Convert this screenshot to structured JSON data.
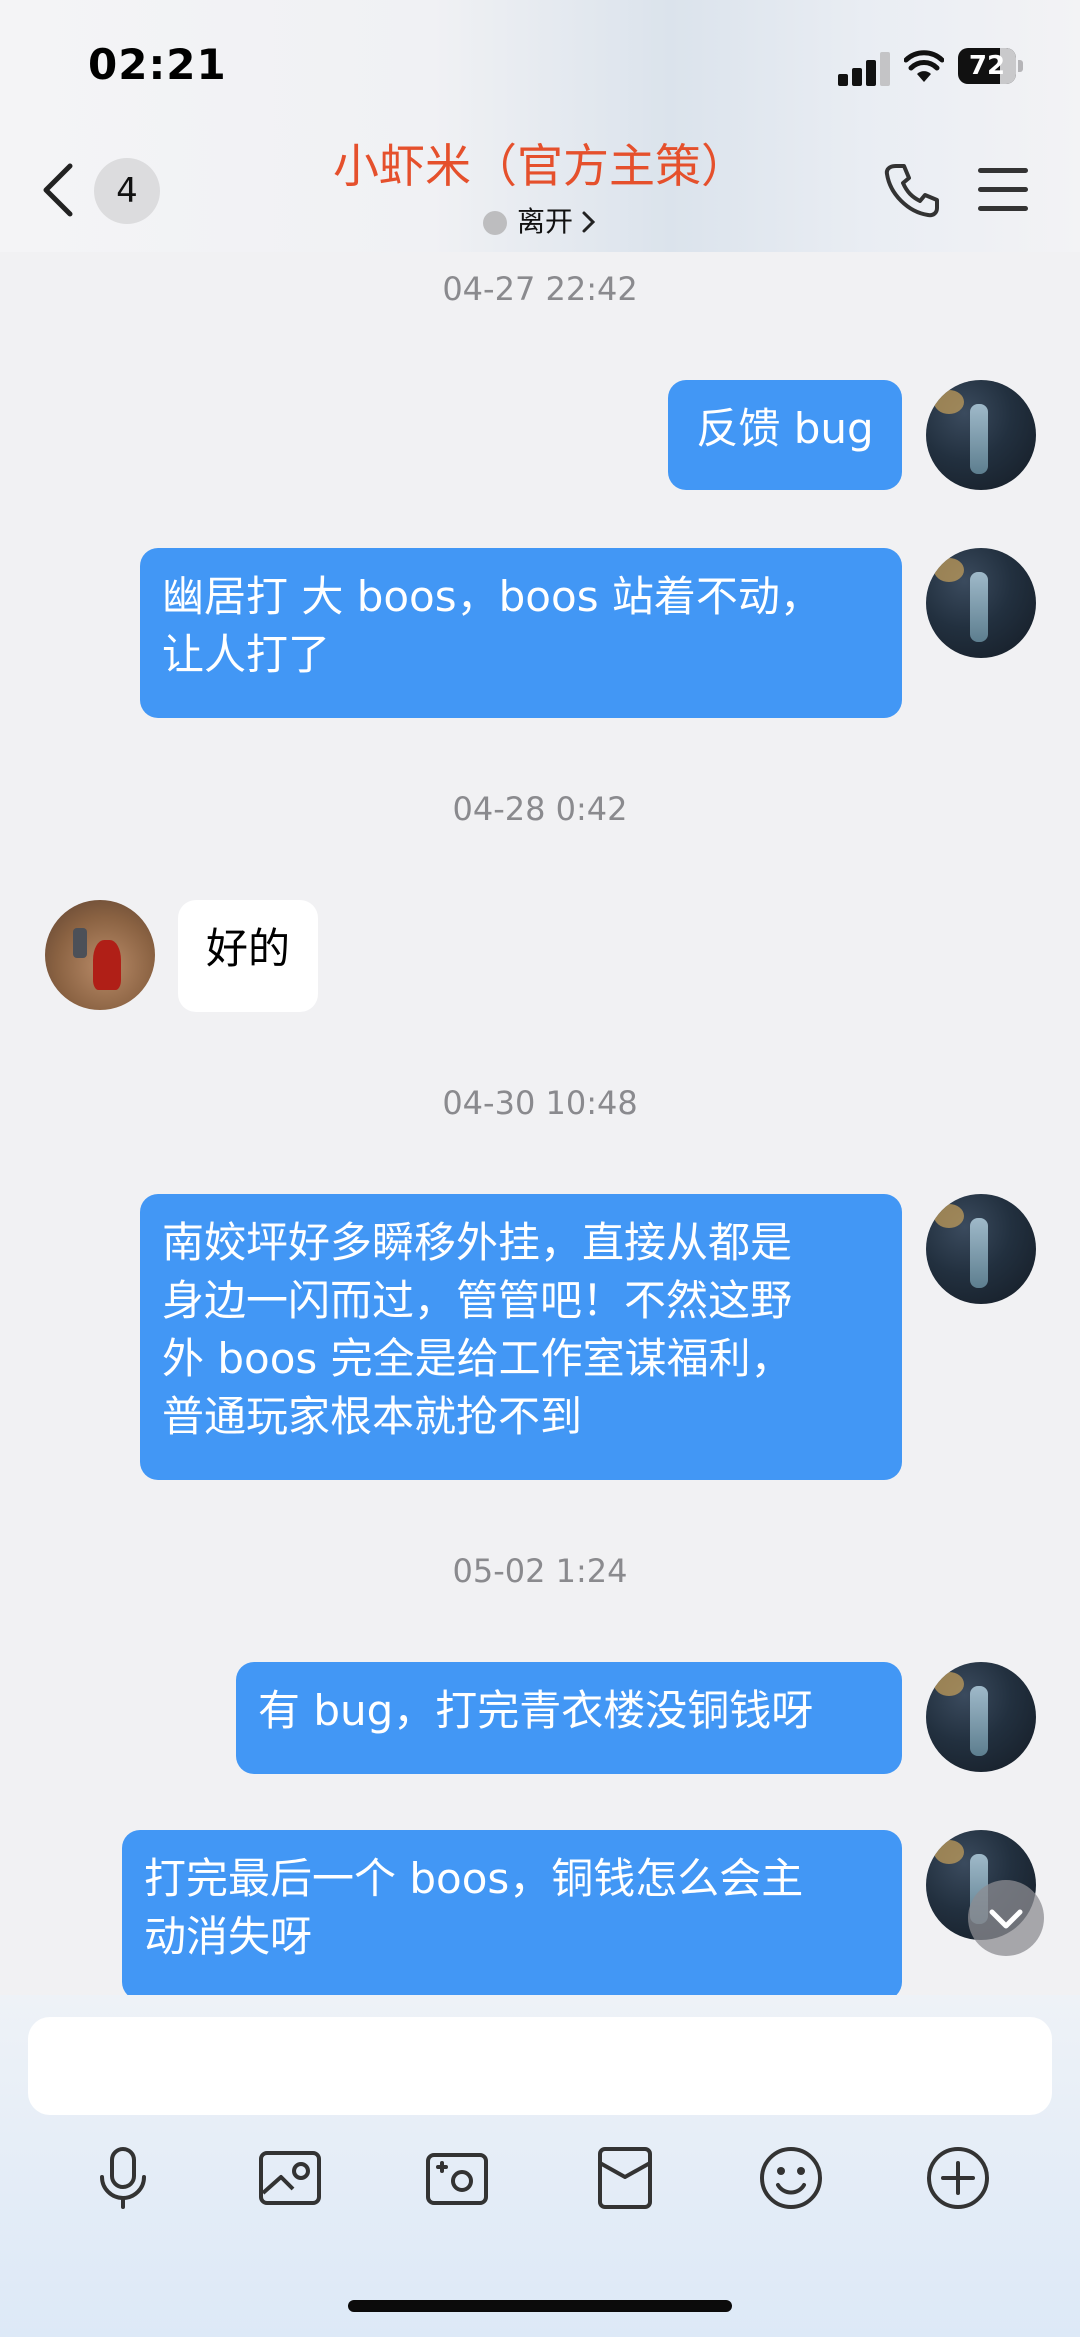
{
  "status_bar": {
    "time": "02:21",
    "battery": "72"
  },
  "header": {
    "unread_count": "4",
    "title": "小虾米（官方主策）",
    "status": "离开",
    "accent_color": "#e5502c"
  },
  "messages": [
    {
      "type": "timestamp",
      "text": "04-27 22:42"
    },
    {
      "type": "outgoing",
      "text": "反馈 bug"
    },
    {
      "type": "outgoing",
      "lines": [
        "幽居打 大 boos，boos 站着不动，",
        "让人打了"
      ]
    },
    {
      "type": "timestamp",
      "text": "04-28 0:42"
    },
    {
      "type": "incoming",
      "text": "好的"
    },
    {
      "type": "timestamp",
      "text": "04-30 10:48"
    },
    {
      "type": "outgoing",
      "lines": [
        "南姣坪好多瞬移外挂，直接从都是",
        "身边一闪而过，管管吧！不然这野",
        "外 boos 完全是给工作室谋福利，",
        "普通玩家根本就抢不到"
      ]
    },
    {
      "type": "timestamp",
      "text": "05-02 1:24"
    },
    {
      "type": "outgoing",
      "text": "有 bug，打完青衣楼没铜钱呀"
    },
    {
      "type": "outgoing",
      "lines": [
        "打完最后一个 boos，铜钱怎么会主",
        "动消失呀"
      ]
    }
  ],
  "colors": {
    "outgoing_bubble": "#4297f5",
    "incoming_bubble": "#ffffff",
    "background": "#f1f1f3"
  },
  "input": {
    "placeholder": ""
  },
  "toolbar_icons": [
    "microphone-icon",
    "image-icon",
    "camera-icon",
    "red-packet-icon",
    "emoji-icon",
    "plus-icon"
  ]
}
